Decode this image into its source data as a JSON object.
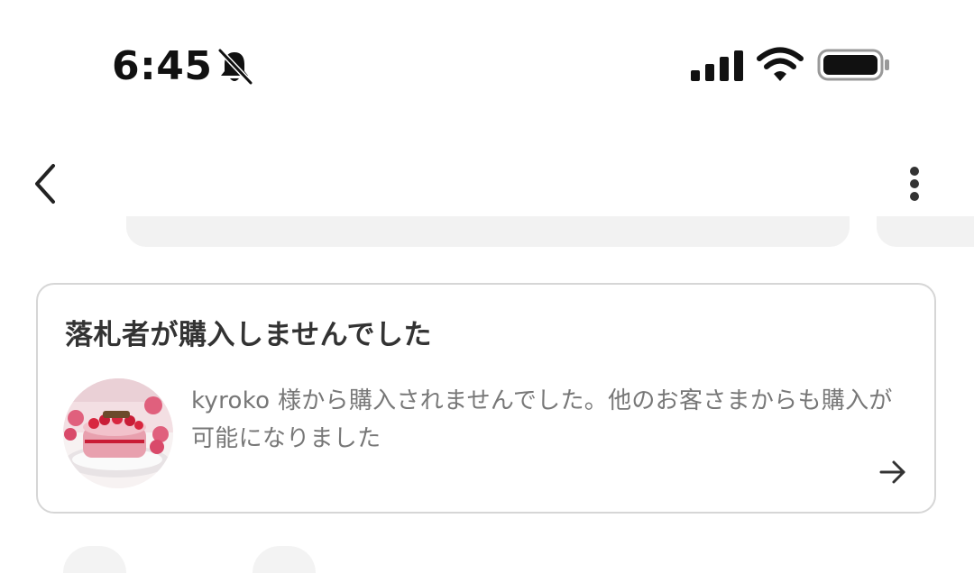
{
  "status_bar": {
    "time": "6:45",
    "icons": [
      "bell-slash-icon",
      "cellular-signal-icon",
      "wifi-icon",
      "battery-icon"
    ]
  },
  "nav": {
    "back_icon": "chevron-left-icon",
    "more_icon": "vertical-ellipsis-icon"
  },
  "notification_card": {
    "title": "落札者が購入しませんでした",
    "message": "kyroko 様から購入されませんでした。他のお客さまからも購入が可能になりました",
    "thumbnail_icon": "cake-photo",
    "arrow_icon": "arrow-right-icon"
  },
  "colors": {
    "border": "#d6d6d6",
    "title_text": "#333333",
    "message_text": "#777777"
  }
}
